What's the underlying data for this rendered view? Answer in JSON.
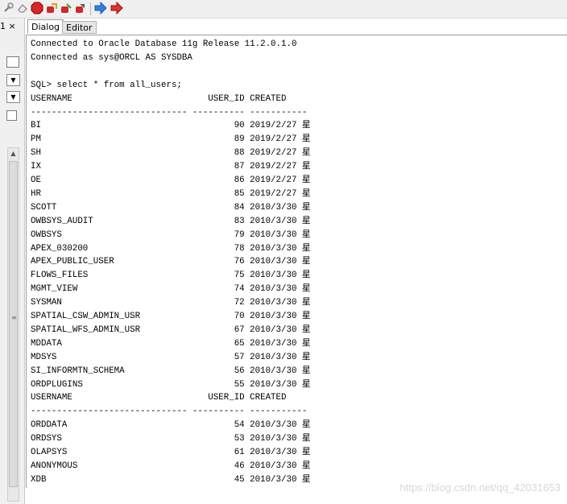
{
  "toolbar": {
    "icons": [
      "settings-wrench-icon",
      "clear-icon",
      "stop-icon",
      "commit-icon",
      "rollback-icon",
      "save-icon",
      "forward-icon",
      "back-icon"
    ]
  },
  "left_tab": {
    "label": "1 ×"
  },
  "tabs": [
    {
      "label": "Dialog",
      "active": true
    },
    {
      "label": "Editor",
      "active": false
    }
  ],
  "output": {
    "lines": [
      "Connected to Oracle Database 11g Release 11.2.0.1.0",
      "Connected as sys@ORCL AS SYSDBA",
      "",
      "SQL> select * from all_users;",
      "USERNAME                          USER_ID CREATED",
      "------------------------------ ---------- -----------",
      "BI                                     90 2019/2/27 星",
      "PM                                     89 2019/2/27 星",
      "SH                                     88 2019/2/27 星",
      "IX                                     87 2019/2/27 星",
      "OE                                     86 2019/2/27 星",
      "HR                                     85 2019/2/27 星",
      "SCOTT                                  84 2010/3/30 星",
      "OWBSYS_AUDIT                           83 2010/3/30 星",
      "OWBSYS                                 79 2010/3/30 星",
      "APEX_030200                            78 2010/3/30 星",
      "APEX_PUBLIC_USER                       76 2010/3/30 星",
      "FLOWS_FILES                            75 2010/3/30 星",
      "MGMT_VIEW                              74 2010/3/30 星",
      "SYSMAN                                 72 2010/3/30 星",
      "SPATIAL_CSW_ADMIN_USR                  70 2010/3/30 星",
      "SPATIAL_WFS_ADMIN_USR                  67 2010/3/30 星",
      "MDDATA                                 65 2010/3/30 星",
      "MDSYS                                  57 2010/3/30 星",
      "SI_INFORMTN_SCHEMA                     56 2010/3/30 星",
      "ORDPLUGINS                             55 2010/3/30 星",
      "USERNAME                          USER_ID CREATED",
      "------------------------------ ---------- -----------",
      "ORDDATA                                54 2010/3/30 星",
      "ORDSYS                                 53 2010/3/30 星",
      "OLAPSYS                                61 2010/3/30 星",
      "ANONYMOUS                              46 2010/3/30 星",
      "XDB                                    45 2010/3/30 星"
    ]
  },
  "watermark": "https://blog.csdn.net/qq_42031653"
}
